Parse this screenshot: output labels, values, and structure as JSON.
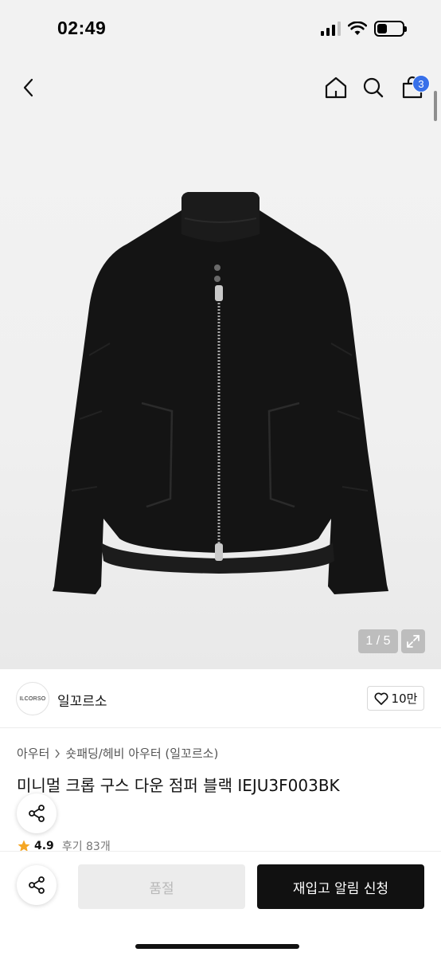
{
  "status_bar": {
    "time": "02:49",
    "icons": [
      "signal-icon",
      "wifi-icon",
      "battery-icon"
    ],
    "battery_level": 0.4
  },
  "nav": {
    "icons": [
      "back-arrow-icon",
      "home-icon",
      "search-icon",
      "cart-icon"
    ],
    "cart_count": "3",
    "badge_color": "#3870e9"
  },
  "gallery": {
    "product_image": "black cropped down jumper with silver two-way zipper",
    "page_indicator": "1 / 5",
    "icons": [
      "expand-icon"
    ]
  },
  "brand": {
    "logo_text": "ILCORSO",
    "name": "일꼬르소",
    "like_count": "10만",
    "icons": [
      "heart-icon"
    ]
  },
  "breadcrumb": {
    "level1": "아우터",
    "level2": "숏패딩/헤비 아우터 (일꼬르소)",
    "icons": [
      "chevron-right-icon"
    ]
  },
  "product": {
    "title": "미니멀 크롭 구스 다운 점퍼 블랙 IEJU3F003BK",
    "rating": "4.9",
    "review_label": "후기 83개",
    "icons": [
      "star-icon",
      "share-icon"
    ],
    "star_color": "#f5a623"
  },
  "bottom_bar": {
    "soldout_label": "품절",
    "restock_label": "재입고 알림 신청"
  }
}
